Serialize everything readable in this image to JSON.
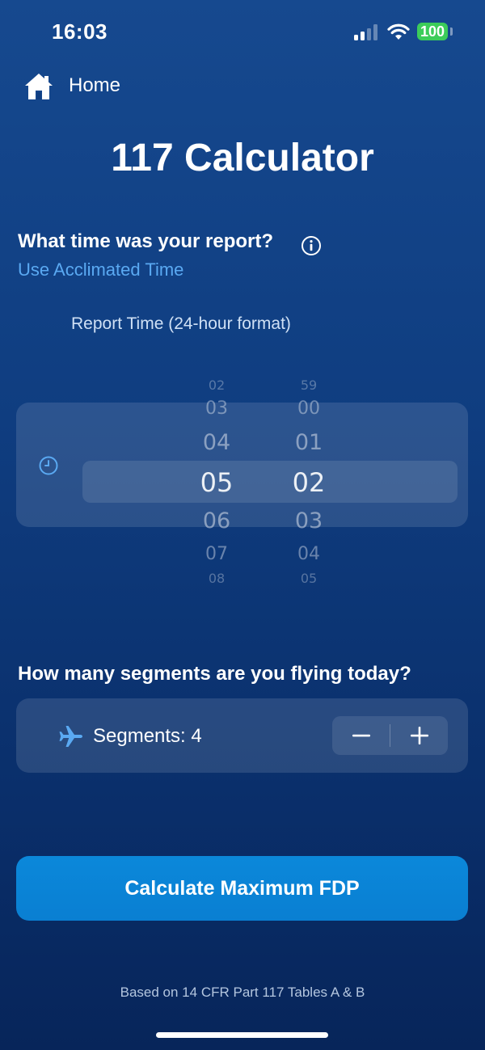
{
  "status_bar": {
    "time": "16:03",
    "battery": "100"
  },
  "nav": {
    "home_label": "Home",
    "home_icon": "house-icon"
  },
  "title": "117 Calculator",
  "report": {
    "question": "What time was your report?",
    "acclimated_link": "Use Acclimated Time",
    "picker_caption": "Report Time (24-hour format)",
    "hours": [
      "02",
      "03",
      "04",
      "05",
      "06",
      "07",
      "08"
    ],
    "minutes": [
      "59",
      "00",
      "01",
      "02",
      "03",
      "04",
      "05"
    ],
    "selected_hour": "05",
    "selected_minute": "02"
  },
  "segments": {
    "question": "How many segments are you flying today?",
    "label": "Segments: 4",
    "count": 4
  },
  "calculate_button": "Calculate Maximum FDP",
  "footer": "Based on 14 CFR Part 117 Tables A & B",
  "colors": {
    "accent_link": "#5aa9f2",
    "button": "#0a7fd2",
    "battery": "#3ccc5a"
  }
}
